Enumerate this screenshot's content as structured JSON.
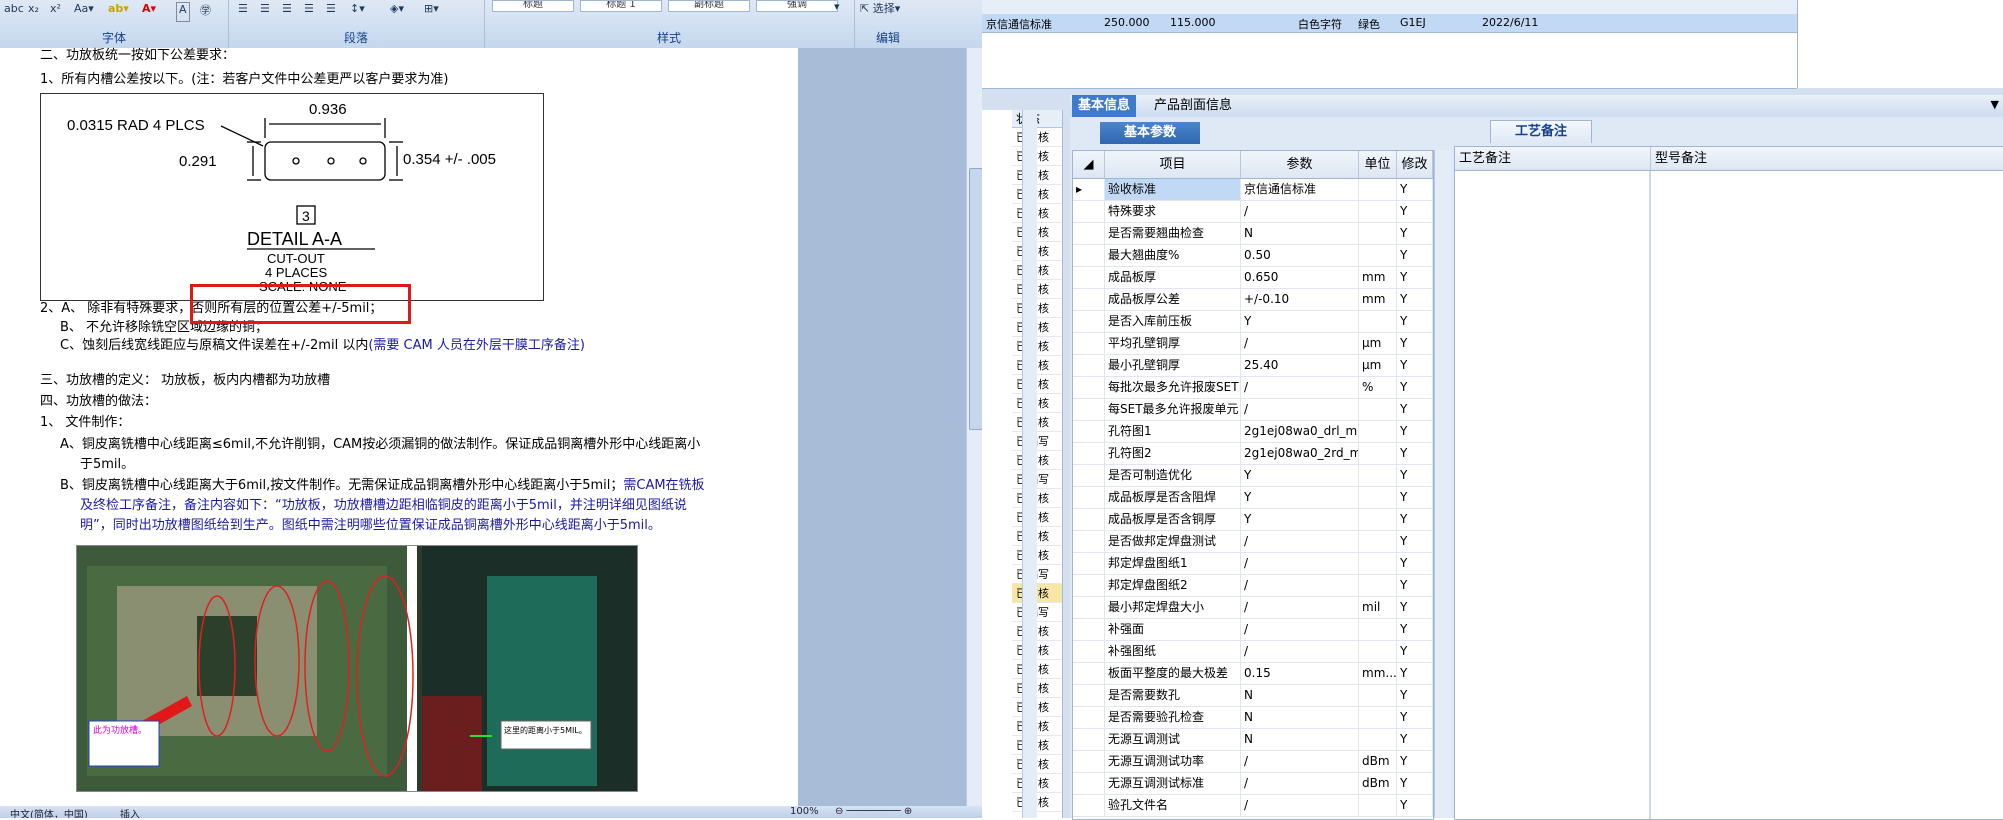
{
  "word": {
    "ribbon": {
      "font_group": "字体",
      "paragraph_group": "段落",
      "styles_group": "样式",
      "edit_group": "编辑",
      "select_label": "选择",
      "style_boxes": [
        "标题",
        "标题 1",
        "副标题",
        "强调"
      ]
    },
    "doc": {
      "line0": "二、功放板统一按如下公差要求：",
      "line1": "1、所有内槽公差按以下。(注：若客户文件中公差更严以客户要求为准)",
      "drawing": {
        "dim_top": "0.936",
        "radius": "0.0315 RAD 4 PLCS",
        "dim_left": "0.291",
        "dim_right": "0.354 +/- .005",
        "callout": "3",
        "detail": "DETAIL A-A",
        "cutout": "CUT-OUT",
        "places": "4 PLACES",
        "scale": "SCALE: NONE"
      },
      "line2a": "2、A、  除非有特殊要求，",
      "line2b": "否则所有层的位置公差+/-5mil；",
      "line3": "B、  不允许移除铣空区域边缘的铜；",
      "line4a": "C、蚀刻后线宽线距应与原稿文件误差在+/-2mil 以内",
      "line4b": "(需要 CAM 人员在外层干膜工序备注)",
      "line5": "三、功放槽的定义：  功放板，板内内槽都为功放槽",
      "line6": "四、功放槽的做法：",
      "line7": "1、  文件制作：",
      "line8": "A、铜皮离铣槽中心线距离≤6mil,不允许削铜，CAM按必须漏铜的做法制作。保证成品铜离槽外形中心线距离小",
      "line9": "于5mil。",
      "line10a": "B、铜皮离铣槽中心线距离大于6mil,按文件制作。无需保证成品铜离槽外形中心线距离小于5mil；",
      "line10b": "需CAM在铣板",
      "line11": "及终检工序备注，备注内容如下：“功放板，功放槽槽边距相临铜皮的距离小于5mil，并注明详细见图纸说",
      "line12": "明”，同时出功放槽图纸给到生产。图纸中需注明哪些位置保证成品铜离槽外形中心线距离小于5mil。",
      "photo_label1": "此为功放槽。",
      "photo_label2": "这里的距离小于5MIL。"
    },
    "status": {
      "lang": "中文(简体，中国)",
      "mode": "插入",
      "zoom": "100%"
    }
  },
  "app": {
    "top_row": {
      "standard": "京信通信标准",
      "v1": "250.000",
      "v2": "115.000",
      "char": "白色字符",
      "color": "绿色",
      "code": "G1EJ",
      "date": "2022/6/11"
    },
    "status_header": "状态",
    "status_rows": [
      "已审核",
      "已审核",
      "已审核",
      "已审核",
      "已审核",
      "已审核",
      "已审核",
      "已审核",
      "已审核",
      "已审核",
      "已审核",
      "已审核",
      "已审核",
      "已审核",
      "已审核",
      "已审核",
      "已编写",
      "已审核",
      "已编写",
      "已审核",
      "已审核",
      "已审核",
      "已审核",
      "已编写",
      "已审核",
      "已编写",
      "已审核",
      "已审核",
      "已审核",
      "已审核",
      "已审核",
      "已审核",
      "已审核",
      "已审核",
      "已审核",
      "已审核"
    ],
    "tabs": [
      "基本信息",
      "产品剖面信息"
    ],
    "subtab": "基本参数",
    "param_headers": [
      "项目",
      "参数",
      "单位",
      "修改"
    ],
    "params": [
      [
        "验收标准",
        "京信通信标准",
        "",
        "Y"
      ],
      [
        "特殊要求",
        "/",
        "",
        "Y"
      ],
      [
        "是否需要翘曲检查",
        "N",
        "",
        "Y"
      ],
      [
        "最大翘曲度%",
        "0.50",
        "",
        "Y"
      ],
      [
        "成品板厚",
        "0.650",
        "mm",
        "Y"
      ],
      [
        "成品板厚公差",
        "+/-0.10",
        "mm",
        "Y"
      ],
      [
        "是否入库前压板",
        "Y",
        "",
        "Y"
      ],
      [
        "平均孔壁铜厚",
        "/",
        "μm",
        "Y"
      ],
      [
        "最小孔壁铜厚",
        "25.40",
        "μm",
        "Y"
      ],
      [
        "每批次最多允许报废SET",
        "/",
        "%",
        "Y"
      ],
      [
        "每SET最多允许报废单元",
        "/",
        "",
        "Y"
      ],
      [
        "孔符图1",
        "2g1ej08wa0_drl_m...",
        "",
        "Y"
      ],
      [
        "孔符图2",
        "2g1ej08wa0_2rd_m...",
        "",
        "Y"
      ],
      [
        "是否可制造优化",
        "Y",
        "",
        "Y"
      ],
      [
        "成品板厚是否含阻焊",
        "Y",
        "",
        "Y"
      ],
      [
        "成品板厚是否含铜厚",
        "Y",
        "",
        "Y"
      ],
      [
        "是否做邦定焊盘测试",
        "/",
        "",
        "Y"
      ],
      [
        "邦定焊盘图纸1",
        "/",
        "",
        "Y"
      ],
      [
        "邦定焊盘图纸2",
        "/",
        "",
        "Y"
      ],
      [
        "最小邦定焊盘大小",
        "/",
        "mil",
        "Y"
      ],
      [
        "补强面",
        "/",
        "",
        "Y"
      ],
      [
        "补强图纸",
        "/",
        "",
        "Y"
      ],
      [
        "板面平整度的最大极差",
        "0.15",
        "mm...",
        "Y"
      ],
      [
        "是否需要数孔",
        "N",
        "",
        "Y"
      ],
      [
        "是否需要验孔检查",
        "N",
        "",
        "Y"
      ],
      [
        "无源互调测试",
        "N",
        "",
        "Y"
      ],
      [
        "无源互调测试功率",
        "/",
        "dBm",
        "Y"
      ],
      [
        "无源互调测试标准",
        "/",
        "dBm",
        "Y"
      ],
      [
        "验孔文件名",
        "/",
        "",
        "Y"
      ]
    ],
    "craft_tab": "工艺备注",
    "craft_headers": [
      "工艺备注",
      "型号备注"
    ]
  }
}
